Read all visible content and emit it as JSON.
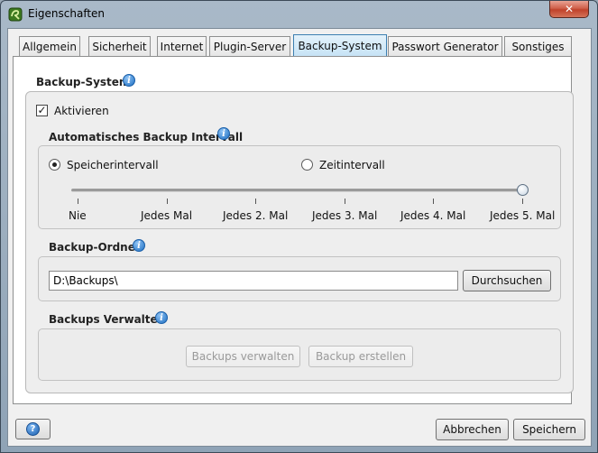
{
  "window": {
    "title": "Eigenschaften",
    "close_label": "✕"
  },
  "tabs": [
    {
      "label": "Allgemein"
    },
    {
      "label": "Sicherheit"
    },
    {
      "label": "Internet"
    },
    {
      "label": "Plugin-Server"
    },
    {
      "label": "Backup-System",
      "active": true
    },
    {
      "label": "Passwort Generator"
    },
    {
      "label": "Sonstiges"
    }
  ],
  "backup_system": {
    "title": "Backup-System",
    "activate_label": "Aktivieren",
    "activate_checked": true,
    "check_mark": "✓"
  },
  "interval": {
    "title": "Automatisches Backup Intervall",
    "radio_storage": "Speicherintervall",
    "radio_time": "Zeitintervall",
    "selected": "Speicherintervall",
    "slider_value_index": 5,
    "tick_labels": [
      "Nie",
      "Jedes Mal",
      "Jedes 2. Mal",
      "Jedes 3. Mal",
      "Jedes 4. Mal",
      "Jedes 5. Mal"
    ]
  },
  "folder": {
    "title": "Backup-Ordner",
    "path": "D:\\Backups\\",
    "browse_label": "Durchsuchen"
  },
  "manage": {
    "title": "Backups Verwalten",
    "manage_label": "Backups verwalten",
    "create_label": "Backup erstellen"
  },
  "footer": {
    "help_label": "?",
    "cancel_label": "Abbrechen",
    "save_label": "Speichern"
  },
  "info_glyph": "i",
  "colors": {
    "active_tab": "#c5e2f5",
    "close_button": "#c0422b",
    "info_icon": "#1f6fc2"
  }
}
